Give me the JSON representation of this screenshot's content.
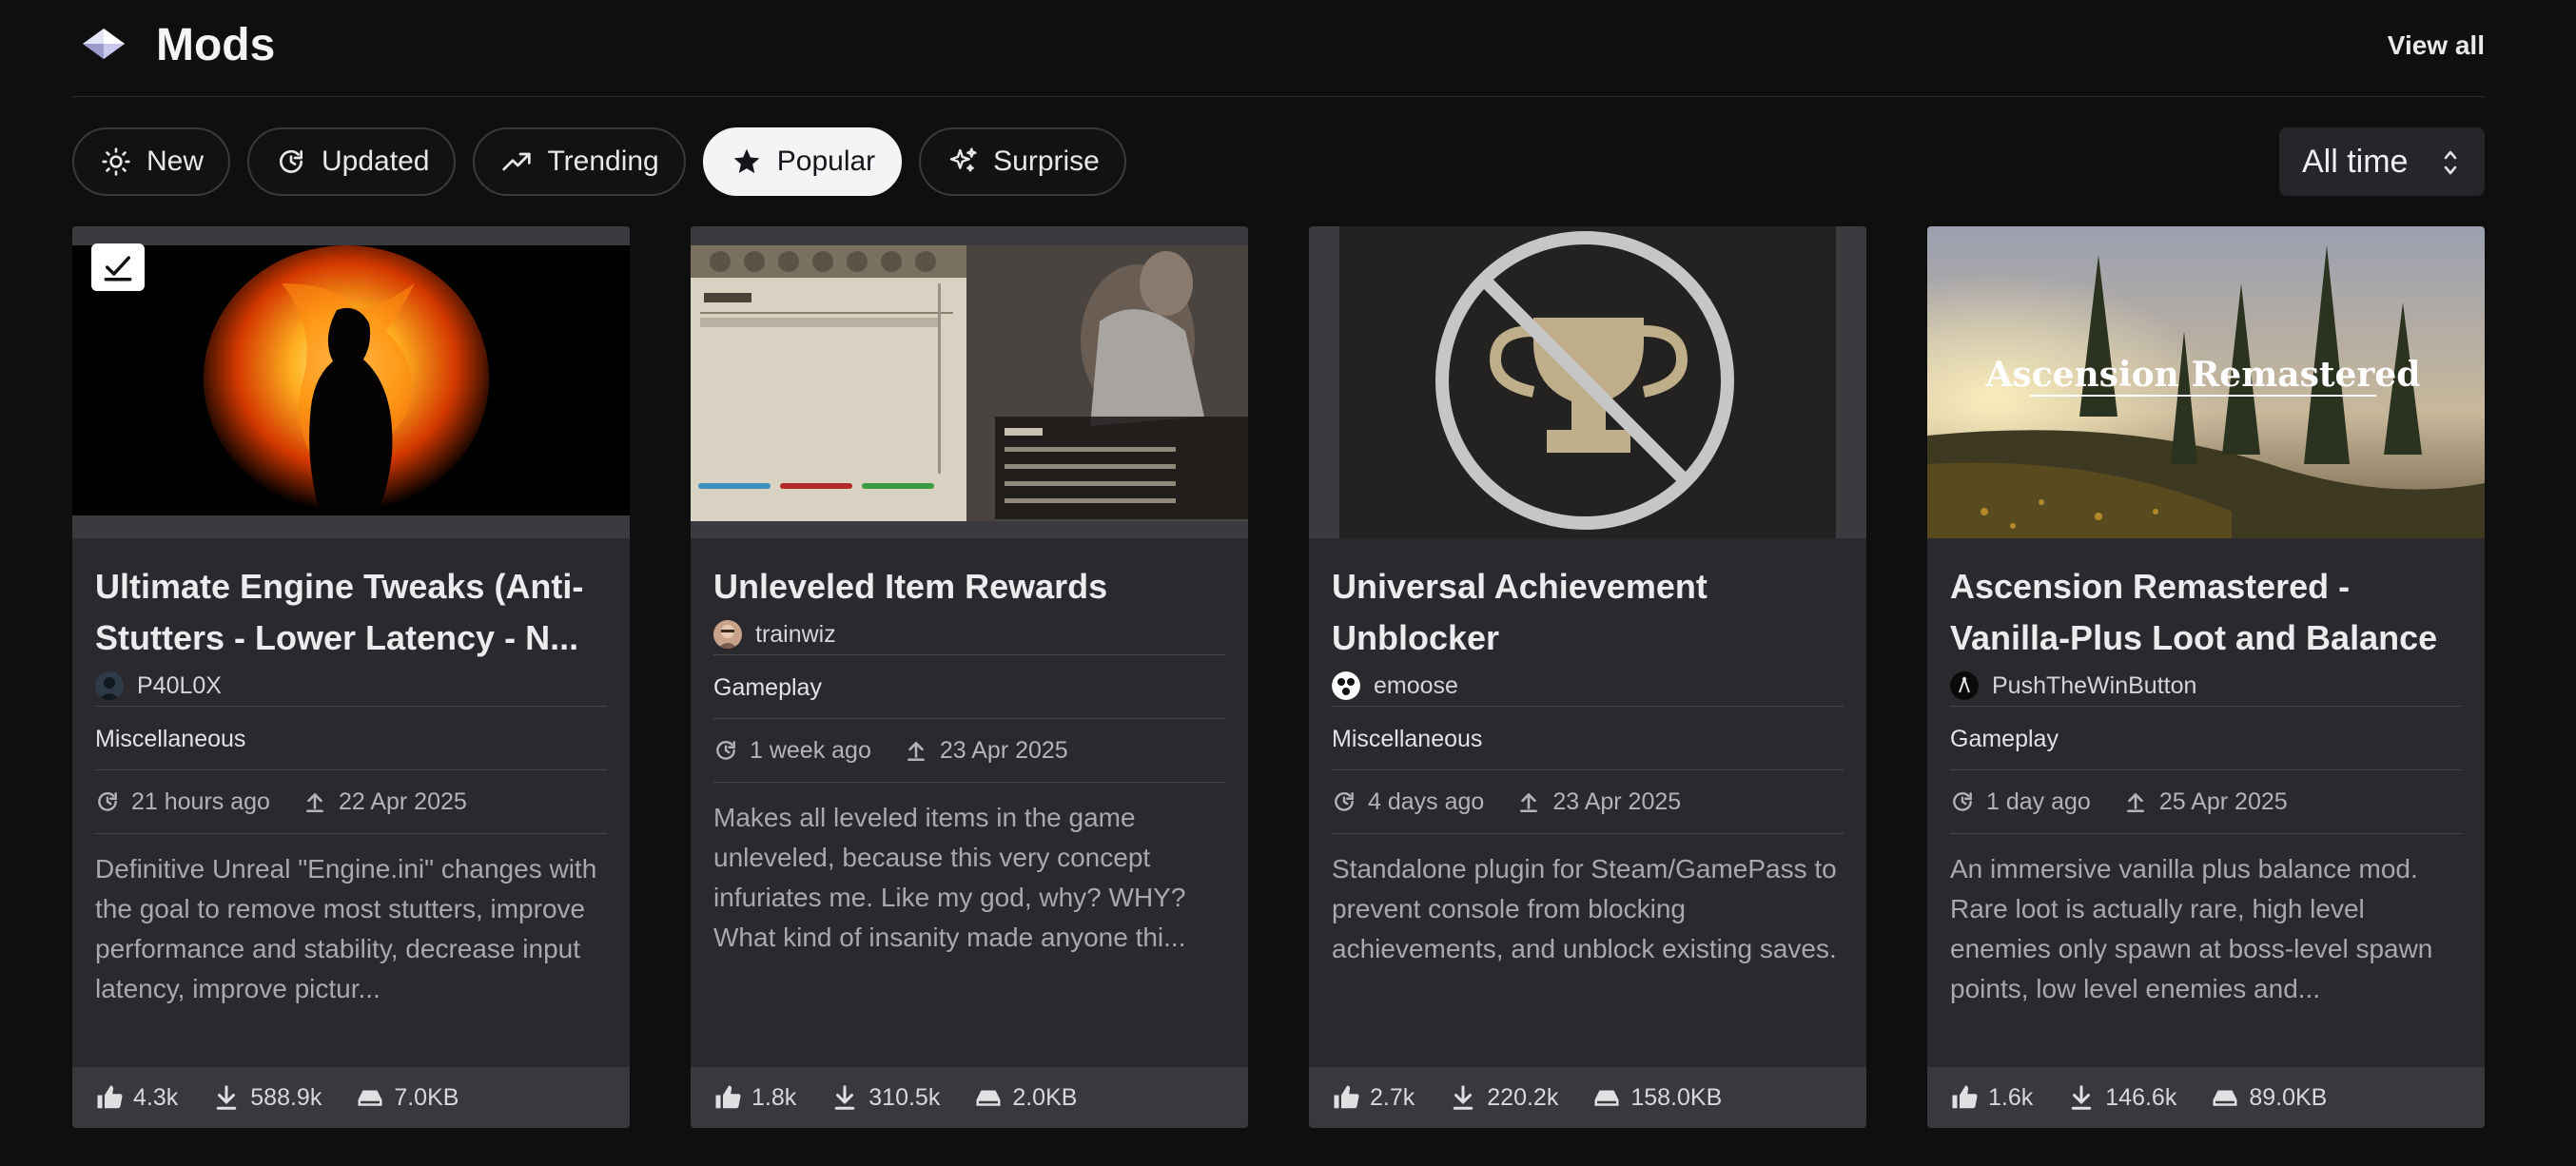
{
  "header": {
    "title": "Mods",
    "view_all": "View all"
  },
  "filters": [
    {
      "label": "New",
      "icon": "sun-icon",
      "active": false
    },
    {
      "label": "Updated",
      "icon": "refresh-icon",
      "active": false
    },
    {
      "label": "Trending",
      "icon": "trending-up-icon",
      "active": false
    },
    {
      "label": "Popular",
      "icon": "star-icon",
      "active": true
    },
    {
      "label": "Surprise",
      "icon": "sparkles-icon",
      "active": false
    }
  ],
  "period": {
    "selected": "All time"
  },
  "mods": [
    {
      "title": "Ultimate Engine Tweaks (Anti-Stutters - Lower Latency - N...",
      "author": "P40L0X",
      "category": "Miscellaneous",
      "updated": "21 hours ago",
      "uploaded": "22 Apr 2025",
      "description": "Definitive Unreal \"Engine.ini\" changes with the goal to remove most stutters, improve performance and stability, decrease input latency, improve pictur...",
      "likes": "4.3k",
      "downloads": "588.9k",
      "size": "7.0KB"
    },
    {
      "title": "Unleveled Item Rewards",
      "author": "trainwiz",
      "category": "Gameplay",
      "updated": "1 week ago",
      "uploaded": "23 Apr 2025",
      "description": "Makes all leveled items in the game unleveled, because this very concept infuriates me. Like my god, why? WHY? What kind of insanity made anyone thi...",
      "likes": "1.8k",
      "downloads": "310.5k",
      "size": "2.0KB"
    },
    {
      "title": "Universal Achievement Unblocker",
      "author": "emoose",
      "category": "Miscellaneous",
      "updated": "4 days ago",
      "uploaded": "23 Apr 2025",
      "description": "Standalone plugin for Steam/GamePass to prevent console from blocking achievements, and unblock existing saves.",
      "likes": "2.7k",
      "downloads": "220.2k",
      "size": "158.0KB"
    },
    {
      "title": "Ascension Remastered - Vanilla-Plus Loot and Balance",
      "author": "PushTheWinButton",
      "category": "Gameplay",
      "updated": "1 day ago",
      "uploaded": "25 Apr 2025",
      "description": "An immersive vanilla plus balance mod. Rare loot is actually rare, high level enemies only spawn at boss-level spawn points, low level enemies and...",
      "likes": "1.6k",
      "downloads": "146.6k",
      "size": "89.0KB",
      "thumbnail_text": "Ascension Remastered"
    }
  ]
}
